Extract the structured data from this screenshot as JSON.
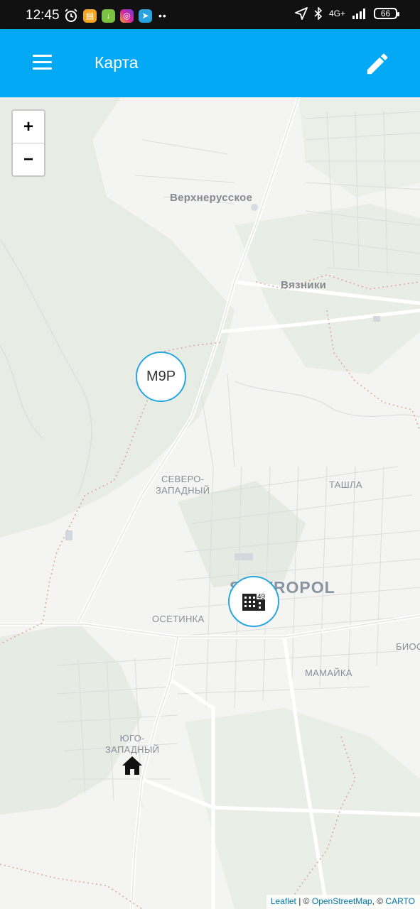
{
  "status_bar": {
    "time": "12:45",
    "network": "4G+",
    "battery": "66",
    "more": "••",
    "icons": [
      "alarm-icon",
      "notes-app-icon",
      "download-app-icon",
      "instagram-icon",
      "telegram-icon",
      "location-arrow-icon",
      "bluetooth-icon",
      "signal-icon",
      "battery-icon"
    ]
  },
  "app_bar": {
    "title": "Карта",
    "menu_icon": "menu-icon",
    "action_icon": "edit-icon",
    "color": "#03a9f4"
  },
  "map": {
    "zoom_in_label": "+",
    "zoom_out_label": "−",
    "labels": {
      "verkhnerusskoe": "Верхнерусское",
      "vyazniki": "Вязники",
      "severo_zapadny_1": "СЕВЕРО-",
      "severo_zapadny_2": "ЗАПАДНЫЙ",
      "tashla": "ТАШЛА",
      "stavropol": "STAVROPOL",
      "osetinka": "ОСЕТИНКА",
      "bios": "БИОС",
      "mamayka": "МАМАЙКА",
      "yugo_zapadny_1": "ЮГО-",
      "yugo_zapadny_2": "ЗАПАДНЫЙ"
    },
    "markers": [
      {
        "type": "text",
        "text": "М9Р"
      },
      {
        "type": "icon",
        "icon": "building-icon",
        "badge": "49"
      }
    ],
    "home_icon": "home-icon",
    "marker_color": "#29a7df"
  },
  "attribution": {
    "leaflet": "Leaflet",
    "sep1": " | © ",
    "osm": "OpenStreetMap",
    "sep2": ", © ",
    "carto": "CARTO"
  }
}
